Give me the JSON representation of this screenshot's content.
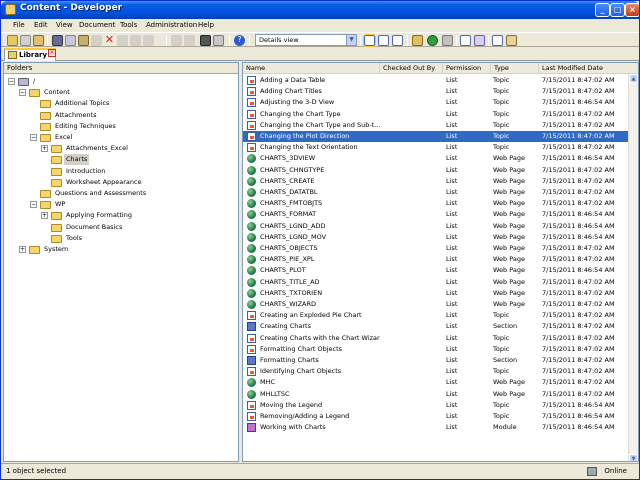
{
  "window": {
    "title": "Content - Developer"
  },
  "titlebar_buttons": [
    "minimize",
    "maximize",
    "close"
  ],
  "menu": [
    "File",
    "Edit",
    "View",
    "Document",
    "Tools",
    "Administration",
    "Help"
  ],
  "toolbar": {
    "view_select": "Details view"
  },
  "tabs": [
    {
      "label": "Library"
    }
  ],
  "folders": {
    "header": "Folders",
    "tree": [
      {
        "label": "/",
        "level": 0,
        "expanded": true,
        "expander": true,
        "root": true
      },
      {
        "label": "Content",
        "level": 1,
        "expanded": true,
        "expander": true
      },
      {
        "label": "Additional Topics",
        "level": 2,
        "expander": false
      },
      {
        "label": "Attachments",
        "level": 2,
        "expander": false
      },
      {
        "label": "Editing Techniques",
        "level": 2,
        "expander": false
      },
      {
        "label": "Excel",
        "level": 2,
        "expanded": true,
        "expander": true
      },
      {
        "label": "Attachments_Excel",
        "level": 3,
        "expanded": false,
        "expander": true
      },
      {
        "label": "Charts",
        "level": 3,
        "expander": false,
        "selected": true
      },
      {
        "label": "Introduction",
        "level": 3,
        "expander": false
      },
      {
        "label": "Worksheet Appearance",
        "level": 3,
        "expander": false
      },
      {
        "label": "Questions and Assessments",
        "level": 2,
        "expander": false
      },
      {
        "label": "WP",
        "level": 2,
        "expanded": true,
        "expander": true
      },
      {
        "label": "Applying Formatting",
        "level": 3,
        "expanded": false,
        "expander": true
      },
      {
        "label": "Document Basics",
        "level": 3,
        "expander": false
      },
      {
        "label": "Tools",
        "level": 3,
        "expander": false
      },
      {
        "label": "System",
        "level": 1,
        "expanded": false,
        "expander": true
      }
    ]
  },
  "list": {
    "columns": [
      "Name",
      "Checked Out By",
      "Permission",
      "Type",
      "Last Modified Date"
    ],
    "rows": [
      {
        "name": "Adding a Data Table",
        "checked_out_by": "",
        "permission": "List",
        "type": "Topic",
        "modified": "7/15/2011 8:47:02 AM",
        "icon": "topic"
      },
      {
        "name": "Adding Chart Titles",
        "checked_out_by": "",
        "permission": "List",
        "type": "Topic",
        "modified": "7/15/2011 8:47:02 AM",
        "icon": "topic"
      },
      {
        "name": "Adjusting the 3-D View",
        "checked_out_by": "",
        "permission": "List",
        "type": "Topic",
        "modified": "7/15/2011 8:46:54 AM",
        "icon": "topic"
      },
      {
        "name": "Changing the Chart Type",
        "checked_out_by": "",
        "permission": "List",
        "type": "Topic",
        "modified": "7/15/2011 8:47:02 AM",
        "icon": "topic"
      },
      {
        "name": "Changing the Chart Type and Sub-t...",
        "checked_out_by": "",
        "permission": "List",
        "type": "Topic",
        "modified": "7/15/2011 8:47:02 AM",
        "icon": "topic"
      },
      {
        "name": "Changing the Plot Direction",
        "checked_out_by": "",
        "permission": "List",
        "type": "Topic",
        "modified": "7/15/2011 8:47:02 AM",
        "icon": "topic",
        "selected": true
      },
      {
        "name": "Changing the Text Orientation",
        "checked_out_by": "",
        "permission": "List",
        "type": "Topic",
        "modified": "7/15/2011 8:47:02 AM",
        "icon": "topic"
      },
      {
        "name": "CHARTS_3DVIEW",
        "checked_out_by": "",
        "permission": "List",
        "type": "Web Page",
        "modified": "7/15/2011 8:46:54 AM",
        "icon": "web"
      },
      {
        "name": "CHARTS_CHNGTYPE",
        "checked_out_by": "",
        "permission": "List",
        "type": "Web Page",
        "modified": "7/15/2011 8:47:02 AM",
        "icon": "web"
      },
      {
        "name": "CHARTS_CREATE",
        "checked_out_by": "",
        "permission": "List",
        "type": "Web Page",
        "modified": "7/15/2011 8:47:02 AM",
        "icon": "web"
      },
      {
        "name": "CHARTS_DATATBL",
        "checked_out_by": "",
        "permission": "List",
        "type": "Web Page",
        "modified": "7/15/2011 8:47:02 AM",
        "icon": "web"
      },
      {
        "name": "CHARTS_FMTOBJTS",
        "checked_out_by": "",
        "permission": "List",
        "type": "Web Page",
        "modified": "7/15/2011 8:47:02 AM",
        "icon": "web"
      },
      {
        "name": "CHARTS_FORMAT",
        "checked_out_by": "",
        "permission": "List",
        "type": "Web Page",
        "modified": "7/15/2011 8:46:54 AM",
        "icon": "web"
      },
      {
        "name": "CHARTS_LGND_ADD",
        "checked_out_by": "",
        "permission": "List",
        "type": "Web Page",
        "modified": "7/15/2011 8:46:54 AM",
        "icon": "web"
      },
      {
        "name": "CHARTS_LGND_MOV",
        "checked_out_by": "",
        "permission": "List",
        "type": "Web Page",
        "modified": "7/15/2011 8:46:54 AM",
        "icon": "web"
      },
      {
        "name": "CHARTS_OBJECTS",
        "checked_out_by": "",
        "permission": "List",
        "type": "Web Page",
        "modified": "7/15/2011 8:47:02 AM",
        "icon": "web"
      },
      {
        "name": "CHARTS_PIE_XPL",
        "checked_out_by": "",
        "permission": "List",
        "type": "Web Page",
        "modified": "7/15/2011 8:47:02 AM",
        "icon": "web"
      },
      {
        "name": "CHARTS_PLOT",
        "checked_out_by": "",
        "permission": "List",
        "type": "Web Page",
        "modified": "7/15/2011 8:46:54 AM",
        "icon": "web"
      },
      {
        "name": "CHARTS_TITLE_AD",
        "checked_out_by": "",
        "permission": "List",
        "type": "Web Page",
        "modified": "7/15/2011 8:47:02 AM",
        "icon": "web"
      },
      {
        "name": "CHARTS_TXTORIEN",
        "checked_out_by": "",
        "permission": "List",
        "type": "Web Page",
        "modified": "7/15/2011 8:47:02 AM",
        "icon": "web"
      },
      {
        "name": "CHARTS_WIZARD",
        "checked_out_by": "",
        "permission": "List",
        "type": "Web Page",
        "modified": "7/15/2011 8:47:02 AM",
        "icon": "web"
      },
      {
        "name": "Creating an Exploded Pie Chart",
        "checked_out_by": "",
        "permission": "List",
        "type": "Topic",
        "modified": "7/15/2011 8:47:02 AM",
        "icon": "topic"
      },
      {
        "name": "Creating Charts",
        "checked_out_by": "",
        "permission": "List",
        "type": "Section",
        "modified": "7/15/2011 8:47:02 AM",
        "icon": "section"
      },
      {
        "name": "Creating Charts with the Chart Wizard",
        "checked_out_by": "",
        "permission": "List",
        "type": "Topic",
        "modified": "7/15/2011 8:47:02 AM",
        "icon": "topic"
      },
      {
        "name": "Formatting Chart Objects",
        "checked_out_by": "",
        "permission": "List",
        "type": "Topic",
        "modified": "7/15/2011 8:47:02 AM",
        "icon": "topic"
      },
      {
        "name": "Formatting Charts",
        "checked_out_by": "",
        "permission": "List",
        "type": "Section",
        "modified": "7/15/2011 8:47:02 AM",
        "icon": "section"
      },
      {
        "name": "Identifying Chart Objects",
        "checked_out_by": "",
        "permission": "List",
        "type": "Topic",
        "modified": "7/15/2011 8:47:02 AM",
        "icon": "topic"
      },
      {
        "name": "MHC",
        "checked_out_by": "",
        "permission": "List",
        "type": "Web Page",
        "modified": "7/15/2011 8:47:02 AM",
        "icon": "web"
      },
      {
        "name": "MHLLTSC",
        "checked_out_by": "",
        "permission": "List",
        "type": "Web Page",
        "modified": "7/15/2011 8:47:02 AM",
        "icon": "web"
      },
      {
        "name": "Moving the Legend",
        "checked_out_by": "",
        "permission": "List",
        "type": "Topic",
        "modified": "7/15/2011 8:46:54 AM",
        "icon": "topic"
      },
      {
        "name": "Removing/Adding a Legend",
        "checked_out_by": "",
        "permission": "List",
        "type": "Topic",
        "modified": "7/15/2011 8:46:54 AM",
        "icon": "topic"
      },
      {
        "name": "Working with Charts",
        "checked_out_by": "",
        "permission": "List",
        "type": "Module",
        "modified": "7/15/2011 8:46:54 AM",
        "icon": "module"
      }
    ]
  },
  "status": {
    "text": "1 object selected",
    "online": "Online"
  },
  "colors": {
    "title_bar": "#0054e3",
    "selection": "#316ac5",
    "window_bg": "#ece9d8",
    "tab_accent": "#ffc83c"
  }
}
